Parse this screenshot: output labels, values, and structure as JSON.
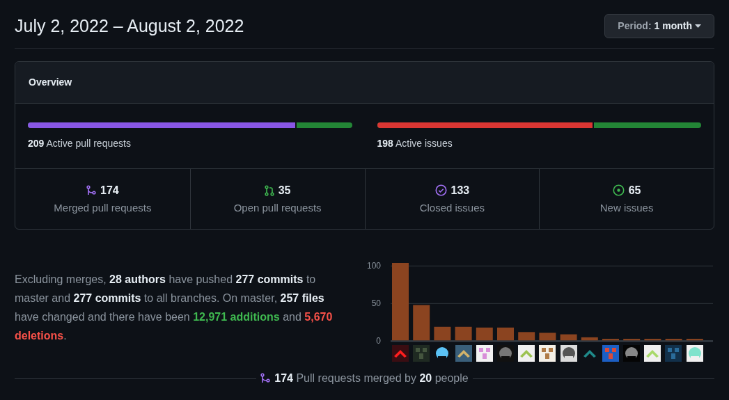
{
  "header": {
    "title": "July 2, 2022 – August 2, 2022",
    "period_button": {
      "label": "Period:",
      "value": "1 month"
    }
  },
  "overview": {
    "title": "Overview",
    "bars": [
      {
        "count": "209",
        "label": "Active pull requests",
        "level": 0.83,
        "kind": "pulls"
      },
      {
        "count": "198",
        "label": "Active issues",
        "level": 0.67,
        "kind": "issues"
      }
    ],
    "stats": [
      {
        "kind": "merged",
        "count": "174",
        "label": "Merged pull requests"
      },
      {
        "kind": "open-pr",
        "count": "35",
        "label": "Open pull requests"
      },
      {
        "kind": "closed",
        "count": "133",
        "label": "Closed issues"
      },
      {
        "kind": "new-issue",
        "count": "65",
        "label": "New issues"
      }
    ]
  },
  "summary": [
    {
      "kind": "plain",
      "text": "Excluding merges, "
    },
    {
      "kind": "bold",
      "text": "28 authors"
    },
    {
      "kind": "plain",
      "text": " have pushed "
    },
    {
      "kind": "bold",
      "text": "277 commits"
    },
    {
      "kind": "plain",
      "text": " to master and "
    },
    {
      "kind": "bold",
      "text": "277 commits"
    },
    {
      "kind": "plain",
      "text": " to all branches. On master, "
    },
    {
      "kind": "bold",
      "text": "257 files"
    },
    {
      "kind": "plain",
      "text": " have changed and there have been "
    },
    {
      "kind": "addition",
      "text": "12,971 additions"
    },
    {
      "kind": "plain",
      "text": " and "
    },
    {
      "kind": "deletion",
      "text": "5,670 deletions"
    },
    {
      "kind": "plain",
      "text": "."
    }
  ],
  "chart_data": {
    "type": "bar",
    "ylim": [
      0,
      104
    ],
    "yticks": [
      0,
      50,
      100
    ],
    "series": [
      {
        "color": "#8b4420",
        "values": [
          104,
          48,
          19,
          19,
          18,
          18,
          12,
          11,
          9,
          5,
          3,
          3,
          3,
          3,
          3
        ]
      }
    ]
  },
  "pull_summary": {
    "count": "174",
    "text": "Pull requests merged by",
    "people": "20",
    "suffix": "people"
  }
}
